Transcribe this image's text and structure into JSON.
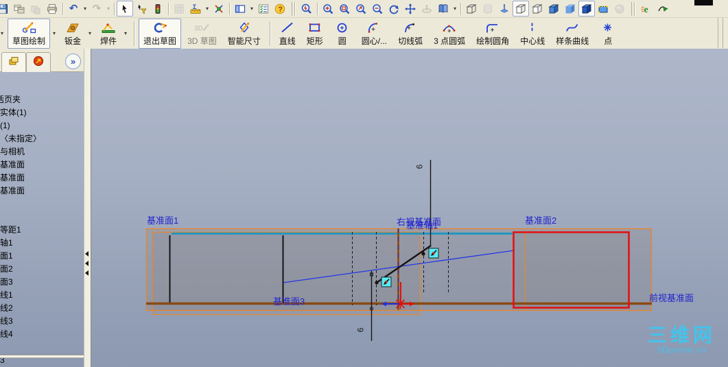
{
  "toolbar_top": {
    "items": [
      {
        "name": "save"
      },
      {
        "name": "viewports"
      },
      {
        "name": "pack-and-go",
        "grayed": true
      },
      {
        "name": "print"
      },
      {
        "name": "sep"
      },
      {
        "name": "undo",
        "dropdown": true
      },
      {
        "name": "redo",
        "grayed": true,
        "dropdown": true
      },
      {
        "name": "sep"
      },
      {
        "name": "select",
        "pressed": true
      },
      {
        "name": "selection-filter"
      },
      {
        "name": "traffic-light"
      },
      {
        "name": "sep"
      },
      {
        "name": "grid",
        "grayed": true
      },
      {
        "name": "measure",
        "dropdown": true
      },
      {
        "name": "mass-properties"
      },
      {
        "name": "sep"
      },
      {
        "name": "view-panels",
        "dropdown": true
      },
      {
        "name": "options-list"
      },
      {
        "name": "help"
      },
      {
        "name": "sep2"
      },
      {
        "name": "zoom-to-fit"
      },
      {
        "name": "sep"
      },
      {
        "name": "zoom-in-out"
      },
      {
        "name": "zoom-area"
      },
      {
        "name": "zoom-to-selection"
      },
      {
        "name": "zoom-out"
      },
      {
        "name": "rotate-view"
      },
      {
        "name": "pan"
      },
      {
        "name": "rotate-about-scene-floor",
        "grayed": true
      },
      {
        "name": "standard-views",
        "dropdown": true
      },
      {
        "name": "sep"
      },
      {
        "name": "wireframe"
      },
      {
        "name": "cylinder",
        "grayed": true
      },
      {
        "name": "temporary-axes"
      },
      {
        "name": "hidden-lines-visible",
        "pressed": true
      },
      {
        "name": "hidden-lines-removed"
      },
      {
        "name": "shaded-with-edges"
      },
      {
        "name": "shaded"
      },
      {
        "name": "display-style",
        "pressed": true
      },
      {
        "name": "section-view"
      },
      {
        "name": "realview",
        "grayed": true
      },
      {
        "name": "sep2"
      },
      {
        "name": "edrawings"
      },
      {
        "name": "edrawings-publish"
      }
    ]
  },
  "toolbar_sketch": {
    "buttons": [
      {
        "type": "lead-dd",
        "name": "flyout"
      },
      {
        "name": "sketch",
        "label": "草图绘制",
        "icon": "sketch",
        "active": true,
        "dropdown": true
      },
      {
        "name": "sheet-metal",
        "label": "钣金",
        "icon": "sheet-metal",
        "dropdown": true
      },
      {
        "name": "weldments",
        "label": "焊件",
        "icon": "weldment",
        "dropdown": true
      },
      {
        "type": "sep"
      },
      {
        "name": "exit-sketch",
        "label": "退出草图",
        "icon": "exit-sketch",
        "active": true
      },
      {
        "name": "3d-sketch",
        "label": "3D 草图",
        "icon": "3d-sketch",
        "disabled": true
      },
      {
        "name": "smart-dimension",
        "label": "智能尺寸",
        "icon": "smart-dimension"
      },
      {
        "type": "sep"
      },
      {
        "name": "line",
        "label": "直线",
        "icon": "line"
      },
      {
        "name": "rectangle",
        "label": "矩形",
        "icon": "rectangle"
      },
      {
        "name": "circle",
        "label": "圆",
        "icon": "circle"
      },
      {
        "name": "centerpoint-arc",
        "label": "圆心/...",
        "icon": "centerpoint-arc"
      },
      {
        "name": "tangent-arc",
        "label": "切线弧",
        "icon": "tangent-arc"
      },
      {
        "name": "three-point-arc",
        "label": "3 点圆弧",
        "icon": "three-point-arc"
      },
      {
        "name": "sketch-fillet",
        "label": "绘制圆角",
        "icon": "sketch-fillet"
      },
      {
        "name": "centerline",
        "label": "中心线",
        "icon": "centerline"
      },
      {
        "name": "spline",
        "label": "样条曲线",
        "icon": "spline"
      },
      {
        "name": "point",
        "label": "点",
        "icon": "point"
      }
    ]
  },
  "left_panel": {
    "tabs": [
      {
        "name": "feature-manager-tab"
      },
      {
        "name": "property-manager-tab"
      }
    ],
    "expand_button": "»",
    "tree_items": [
      {
        "label": "活页夹",
        "shift": true
      },
      {
        "label": "实体(1)"
      },
      {
        "label": "(1)"
      },
      {
        "label": "〈未指定〉"
      },
      {
        "label": "与相机"
      },
      {
        "label": "基准面"
      },
      {
        "label": "基准面"
      },
      {
        "label": "基准面"
      },
      {
        "label": ""
      },
      {
        "label": ""
      },
      {
        "label": "等距1"
      },
      {
        "label": "轴1"
      },
      {
        "label": "面1"
      },
      {
        "label": "面2"
      },
      {
        "label": "面3"
      },
      {
        "label": "线1"
      },
      {
        "label": "线2"
      },
      {
        "label": "线3"
      },
      {
        "label": "线4"
      },
      {
        "label": ""
      },
      {
        "label": "3"
      }
    ]
  },
  "viewport": {
    "plane_labels": {
      "plane1": "基准面1",
      "right_plane": "右视基准面",
      "axis1": "基准轴1",
      "plane2": "基准面2",
      "plane3": "基准面3",
      "front_plane": "前视基准面"
    },
    "dimensions": {
      "top": "6",
      "bottom": "6"
    },
    "watermark": {
      "title": "三维网",
      "subtitle": "3Dportal.cn"
    },
    "colors": {
      "plane_border": "#e8862c",
      "selected_plane": "#e31212",
      "edge_teal": "#2596c0",
      "edge_brown": "#8a4a12",
      "axis_brown": "#9a5212",
      "construction_blue": "#2336e6",
      "label_blue": "#2323cc",
      "relation_cyan": "#58ecf4",
      "watermark_cyan": "#3cc8f2"
    }
  }
}
